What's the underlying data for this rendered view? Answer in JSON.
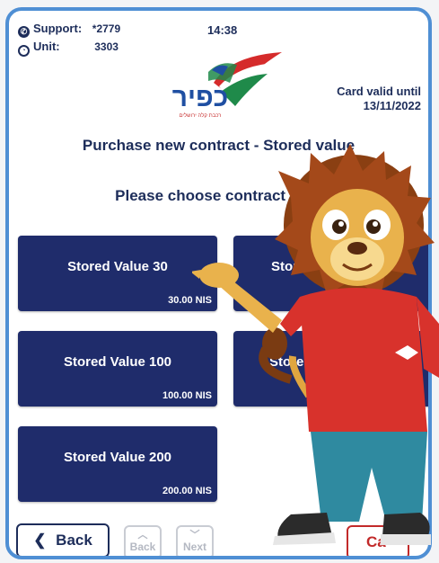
{
  "header": {
    "support_label": "Support:",
    "support_value": "*2779",
    "unit_label": "Unit:",
    "unit_value": "3303",
    "time": "14:38",
    "card_valid_label": "Card valid until",
    "card_valid_date": "13/11/2022"
  },
  "logo": {
    "text": "כפיר",
    "subtext": "רכבת קלה ירושלים",
    "colors": {
      "red": "#d52b2b",
      "green": "#1f8a4a",
      "blue": "#1f4fa2"
    }
  },
  "titles": {
    "main": "Purchase new contract - Stored value",
    "sub": "Please choose contract to"
  },
  "tiles": [
    {
      "name": "Stored Value 30",
      "price": "30.00 NIS"
    },
    {
      "name": "Stor",
      "price": ""
    },
    {
      "name": "Stored Value 100",
      "price": "100.00 NIS"
    },
    {
      "name": "Stored Va",
      "price": ""
    },
    {
      "name": "Stored Value 200",
      "price": "200.00 NIS"
    }
  ],
  "footer": {
    "back_label": "Back",
    "back_nav_label": "Back",
    "next_label": "Next",
    "cancel_label": "Ca"
  },
  "colors": {
    "tile_bg": "#1f2c6b",
    "text_navy": "#1d2d5a",
    "frame_blue": "#4f8fd4",
    "cancel_red": "#c22a2a"
  }
}
